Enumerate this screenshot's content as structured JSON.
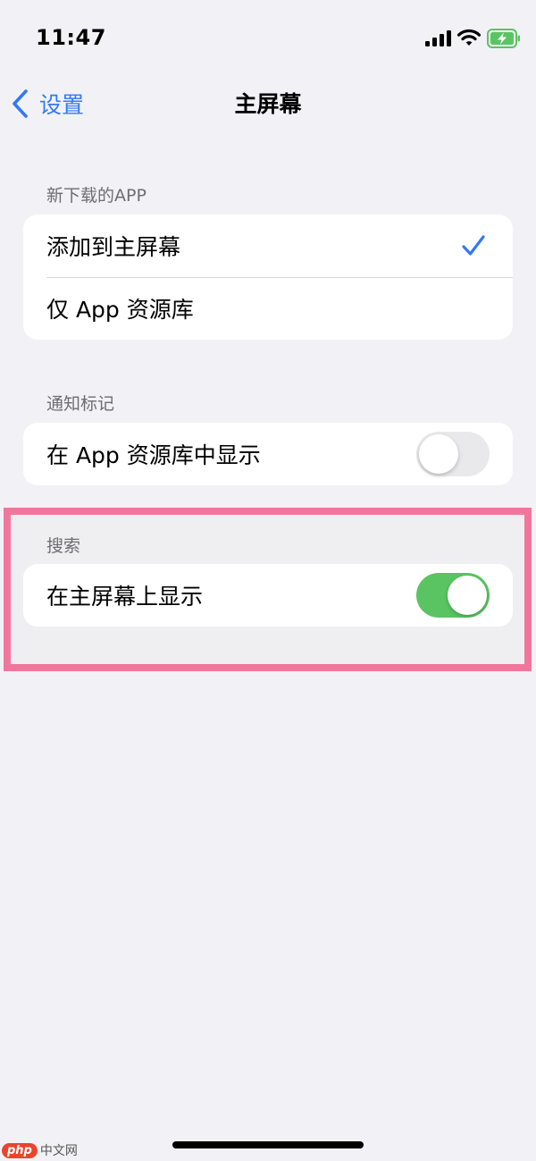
{
  "status_bar": {
    "time": "11:47",
    "icons": [
      "cellular-signal-icon",
      "wifi-icon",
      "battery-charging-icon"
    ]
  },
  "nav": {
    "back_label": "设置",
    "title": "主屏幕"
  },
  "sections": [
    {
      "header": "新下载的APP",
      "rows": [
        {
          "label": "添加到主屏幕",
          "checked": true
        },
        {
          "label": "仅 App 资源库",
          "checked": false
        }
      ]
    },
    {
      "header": "通知标记",
      "rows": [
        {
          "label": "在 App 资源库中显示",
          "toggle": false
        }
      ]
    },
    {
      "header": "搜索",
      "rows": [
        {
          "label": "在主屏幕上显示",
          "toggle": true
        }
      ]
    }
  ],
  "colors": {
    "background": "#f2f2f6",
    "accent": "#3478f6",
    "toggle_on": "#5bc462",
    "toggle_off": "#e9e9eb",
    "highlight": "#f2769c"
  },
  "watermark": {
    "logo": "php",
    "text": "中文网"
  }
}
